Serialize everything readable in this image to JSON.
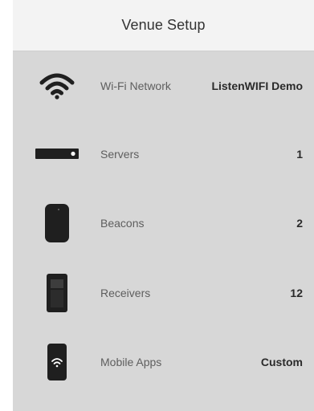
{
  "header": {
    "title": "Venue Setup"
  },
  "items": [
    {
      "icon": "wifi-icon",
      "label": "Wi-Fi Network",
      "value": "ListenWIFI Demo"
    },
    {
      "icon": "server-icon",
      "label": "Servers",
      "value": "1"
    },
    {
      "icon": "beacon-icon",
      "label": "Beacons",
      "value": "2"
    },
    {
      "icon": "receiver-icon",
      "label": "Receivers",
      "value": "12"
    },
    {
      "icon": "mobile-app-icon",
      "label": "Mobile Apps",
      "value": "Custom"
    }
  ],
  "colors": {
    "header_background": "#f3f3f3",
    "list_background": "#d7d7d7",
    "icon_color": "#1f1f1f",
    "label_color": "#5e5e5e",
    "value_color": "#2a2a2a"
  }
}
